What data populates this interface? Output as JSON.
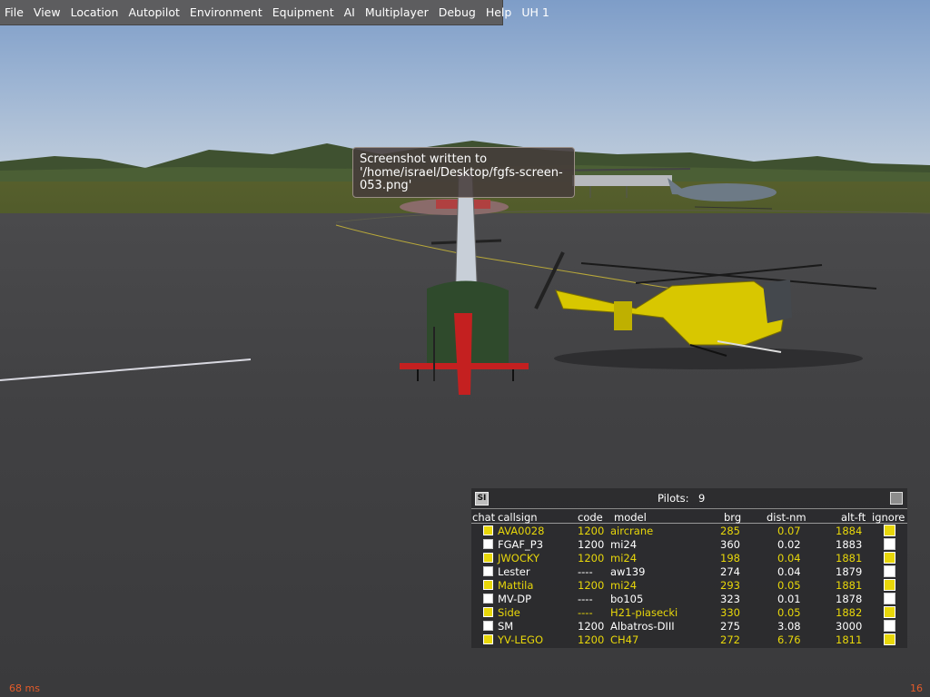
{
  "menu": [
    "File",
    "View",
    "Location",
    "Autopilot",
    "Environment",
    "Equipment",
    "AI",
    "Multiplayer",
    "Debug",
    "Help",
    "UH 1"
  ],
  "tooltip": {
    "line1": "Screenshot written to",
    "line2": "'/home/israel/Desktop/fgfs-screen-",
    "line3": "053.png'"
  },
  "pilot_list": {
    "si_label": "SI",
    "title": "Pilots:",
    "count": "9",
    "columns": [
      "chat",
      "callsign",
      "code",
      "model",
      "brg",
      "dist-nm",
      "alt-ft",
      "ignore"
    ],
    "rows": [
      {
        "callsign": "AVA0028",
        "code": "1200",
        "model": "aircrane",
        "brg": "285",
        "dist": "0.07",
        "alt": "1884",
        "highlight": true
      },
      {
        "callsign": "FGAF_P3",
        "code": "1200",
        "model": "mi24",
        "brg": "360",
        "dist": "0.02",
        "alt": "1883",
        "highlight": false
      },
      {
        "callsign": "JWOCKY",
        "code": "1200",
        "model": "mi24",
        "brg": "198",
        "dist": "0.04",
        "alt": "1881",
        "highlight": true
      },
      {
        "callsign": "Lester",
        "code": "----",
        "model": "aw139",
        "brg": "274",
        "dist": "0.04",
        "alt": "1879",
        "highlight": false
      },
      {
        "callsign": "Mattila",
        "code": "1200",
        "model": "mi24",
        "brg": "293",
        "dist": "0.05",
        "alt": "1881",
        "highlight": true
      },
      {
        "callsign": "MV-DP",
        "code": "----",
        "model": "bo105",
        "brg": "323",
        "dist": "0.01",
        "alt": "1878",
        "highlight": false
      },
      {
        "callsign": "Side",
        "code": "----",
        "model": "H21-piasecki",
        "brg": "330",
        "dist": "0.05",
        "alt": "1882",
        "highlight": true
      },
      {
        "callsign": "SM",
        "code": "1200",
        "model": "Albatros-DIII",
        "brg": "275",
        "dist": "3.08",
        "alt": "3000",
        "highlight": false
      },
      {
        "callsign": "YV-LEGO",
        "code": "1200",
        "model": "CH47",
        "brg": "272",
        "dist": "6.76",
        "alt": "1811",
        "highlight": true
      }
    ]
  },
  "status": {
    "frame_time": "68 ms",
    "fps": "16"
  },
  "colors": {
    "highlight": "#e8d70a",
    "status": "#e25b2a",
    "menubar": "#5d5d5f"
  }
}
